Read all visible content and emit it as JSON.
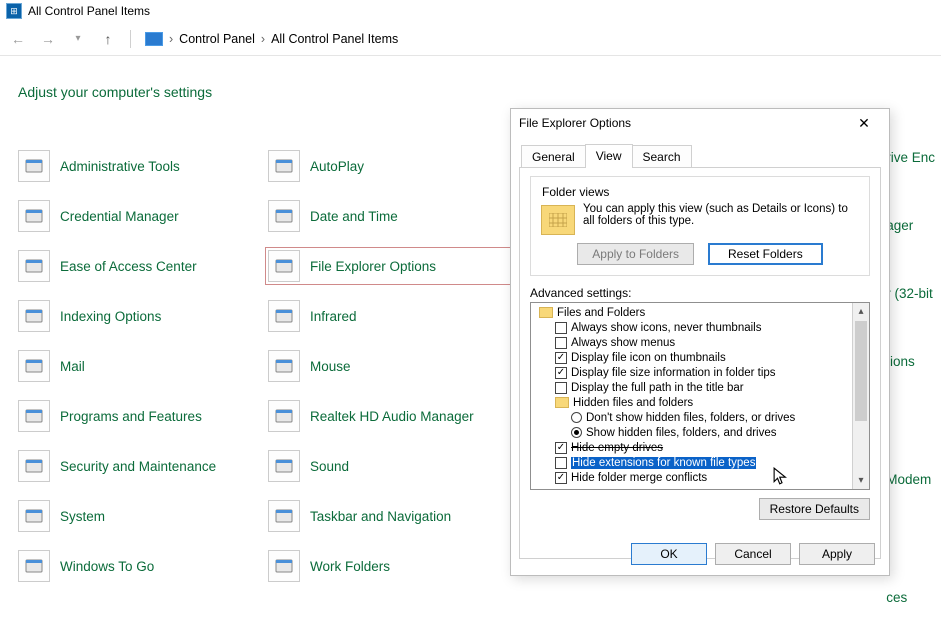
{
  "cp": {
    "title": "All Control Panel Items",
    "breadcrumb": [
      "Control Panel",
      "All Control Panel Items"
    ],
    "heading": "Adjust your computer's settings",
    "items": [
      {
        "label": "Administrative Tools",
        "icon": "tools-icon"
      },
      {
        "label": "AutoPlay",
        "icon": "autoplay-icon"
      },
      {
        "label": "Credential Manager",
        "icon": "credential-icon"
      },
      {
        "label": "Date and Time",
        "icon": "clock-icon"
      },
      {
        "label": "Ease of Access Center",
        "icon": "ease-icon"
      },
      {
        "label": "File Explorer Options",
        "icon": "folder-icon",
        "highlighted": true
      },
      {
        "label": "Indexing Options",
        "icon": "index-icon"
      },
      {
        "label": "Infrared",
        "icon": "infrared-icon"
      },
      {
        "label": "Mail",
        "icon": "mail-icon"
      },
      {
        "label": "Mouse",
        "icon": "mouse-icon"
      },
      {
        "label": "Programs and Features",
        "icon": "programs-icon"
      },
      {
        "label": "Realtek HD Audio Manager",
        "icon": "audio-icon"
      },
      {
        "label": "Security and Maintenance",
        "icon": "flag-icon"
      },
      {
        "label": "Sound",
        "icon": "sound-icon"
      },
      {
        "label": "System",
        "icon": "system-icon"
      },
      {
        "label": "Taskbar and Navigation",
        "icon": "taskbar-icon"
      },
      {
        "label": "Windows To Go",
        "icon": "wtg-icon"
      },
      {
        "label": "Work Folders",
        "icon": "workfolder-icon"
      }
    ],
    "partial_items": [
      "rive Enc",
      "ager",
      "r (32-bit",
      "tions",
      "Modem",
      "ces"
    ]
  },
  "dlg": {
    "title": "File Explorer Options",
    "close": "✕",
    "tabs": {
      "general": "General",
      "view": "View",
      "search": "Search",
      "active": "view"
    },
    "folder_views": {
      "legend": "Folder views",
      "text": "You can apply this view (such as Details or Icons) to all folders of this type.",
      "apply": "Apply to Folders",
      "reset": "Reset Folders"
    },
    "advanced_label": "Advanced settings:",
    "tree": [
      {
        "type": "folder",
        "label": "Files and Folders",
        "indent": 0
      },
      {
        "type": "check",
        "checked": false,
        "label": "Always show icons, never thumbnails",
        "indent": 1
      },
      {
        "type": "check",
        "checked": false,
        "label": "Always show menus",
        "indent": 1
      },
      {
        "type": "check",
        "checked": true,
        "label": "Display file icon on thumbnails",
        "indent": 1
      },
      {
        "type": "check",
        "checked": true,
        "label": "Display file size information in folder tips",
        "indent": 1
      },
      {
        "type": "check",
        "checked": false,
        "label": "Display the full path in the title bar",
        "indent": 1
      },
      {
        "type": "folder",
        "label": "Hidden files and folders",
        "indent": 1
      },
      {
        "type": "radio",
        "checked": false,
        "label": "Don't show hidden files, folders, or drives",
        "indent": 2
      },
      {
        "type": "radio",
        "checked": true,
        "label": "Show hidden files, folders, and drives",
        "indent": 2
      },
      {
        "type": "check",
        "checked": true,
        "label": "Hide empty drives",
        "indent": 1,
        "struck": true
      },
      {
        "type": "check",
        "checked": false,
        "label": "Hide extensions for known file types",
        "indent": 1,
        "selected": true
      },
      {
        "type": "check",
        "checked": true,
        "label": "Hide folder merge conflicts",
        "indent": 1
      }
    ],
    "restore": "Restore Defaults",
    "ok": "OK",
    "cancel": "Cancel",
    "apply": "Apply"
  }
}
